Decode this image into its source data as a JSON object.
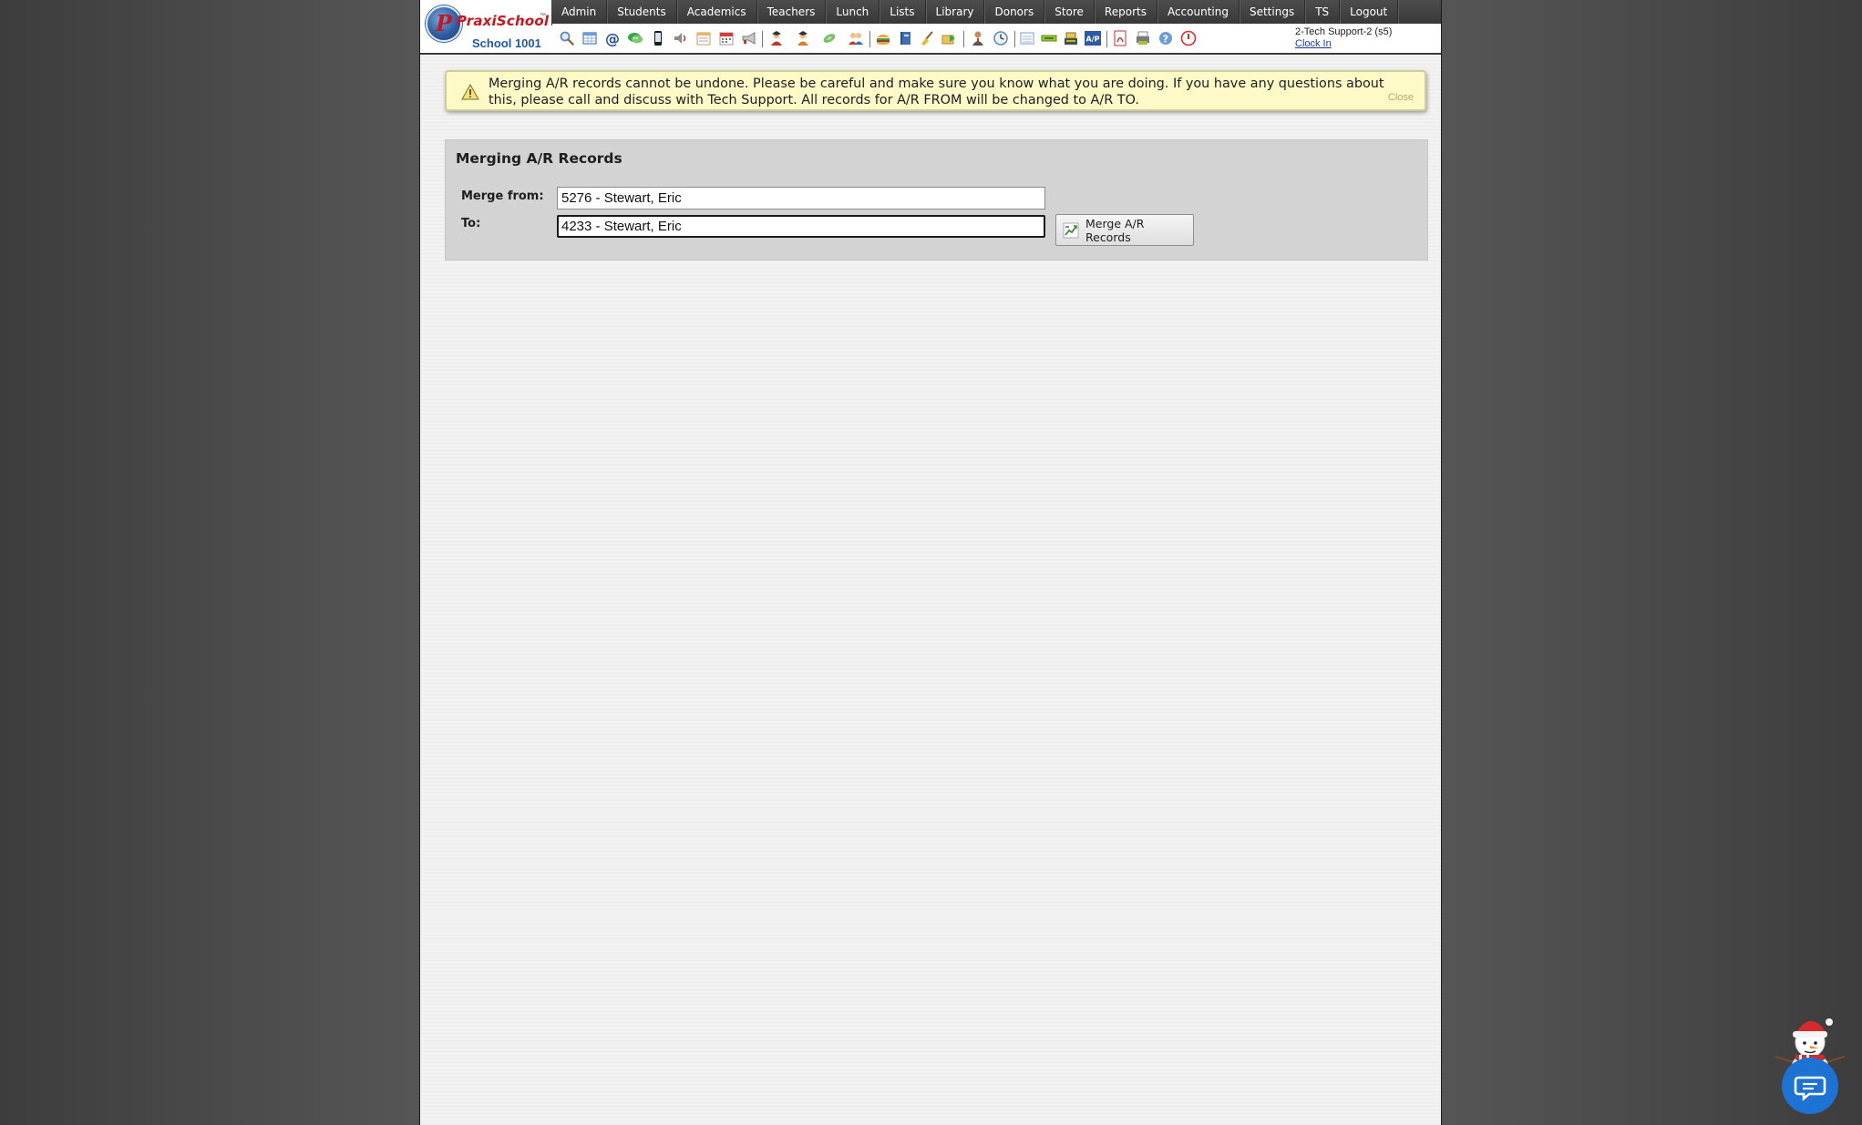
{
  "header": {
    "logo": {
      "brand": "PraxiSchool",
      "trademark": "™",
      "school_name": "School 1001"
    },
    "nav": [
      {
        "label": "Admin"
      },
      {
        "label": "Students"
      },
      {
        "label": "Academics"
      },
      {
        "label": "Teachers"
      },
      {
        "label": "Lunch"
      },
      {
        "label": "Lists"
      },
      {
        "label": "Library"
      },
      {
        "label": "Donors"
      },
      {
        "label": "Store"
      },
      {
        "label": "Reports"
      },
      {
        "label": "Accounting"
      },
      {
        "label": "Settings"
      },
      {
        "label": "TS"
      },
      {
        "label": "Logout"
      }
    ],
    "toolbar_icons": [
      "search-icon",
      "grid-icon",
      "email-icon",
      "chat-icon",
      "mobile-icon",
      "speaker-icon",
      "calendar-list-icon",
      "calendar-icon",
      "megaphone-icon",
      "student-red-icon",
      "student-orange-icon",
      "student-green-icon",
      "students-group-icon",
      "lunch-icon",
      "book-icon",
      "broom-icon",
      "inbox-icon",
      "teacher-icon",
      "clock-icon",
      "document-icon",
      "ticket-icon",
      "cash-register-icon",
      "ap-icon",
      "pdf-icon",
      "printer-icon",
      "help-icon",
      "power-icon"
    ],
    "user": {
      "name": "2-Tech Support-2 (s5)",
      "clock_in": "Clock In"
    }
  },
  "alert": {
    "message": "Merging A/R records cannot be undone. Please be careful and make sure you know what you are doing. If you have any questions about this, please call and discuss with Tech Support. All records for A/R FROM will be changed to A/R TO.",
    "close_label": "Close",
    "icon": "warning-icon"
  },
  "panel": {
    "title": "Merging A/R Records",
    "merge_from_label": "Merge from:",
    "merge_from_value": "5276 - Stewart, Eric",
    "to_label": "To:",
    "to_value": "4233 - Stewart, Eric",
    "merge_button_label": "Merge A/R Records"
  },
  "colors": {
    "nav_bg": "#404040",
    "alert_bg": "#fdfac8",
    "panel_bg": "#d3d3d3",
    "chat_blue": "#1d73d4",
    "brand_red": "#c7161d",
    "brand_blue": "#1f58a8"
  }
}
